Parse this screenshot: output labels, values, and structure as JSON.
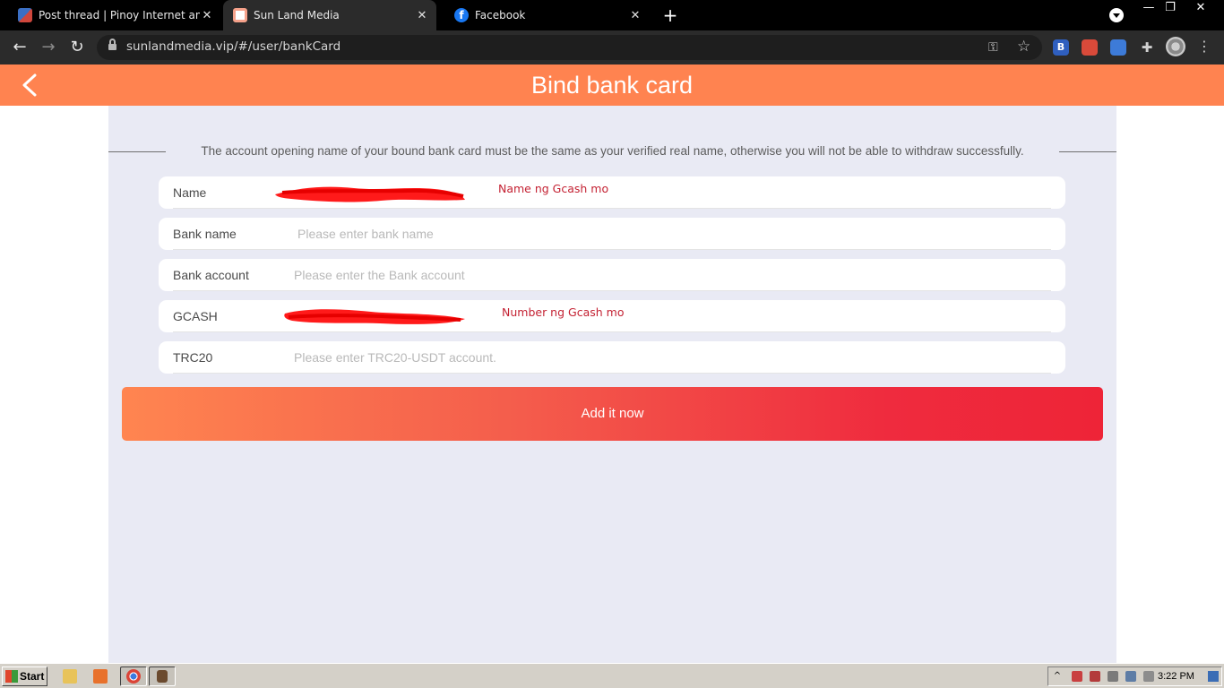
{
  "browser": {
    "tabs": [
      {
        "title": "Post thread | Pinoy Internet and Tec",
        "active": false
      },
      {
        "title": "Sun Land Media",
        "active": true
      },
      {
        "title": "Facebook",
        "active": false
      }
    ],
    "url": "sunlandmedia.vip/#/user/bankCard",
    "new_tab_label": "+",
    "window_controls": {
      "minimize": "—",
      "maximize": "❐",
      "close": "✕"
    }
  },
  "page": {
    "title": "Bind bank card",
    "notice": "The account opening name of your bound bank card must be the same as your verified real name, otherwise you will not be able to withdraw successfully.",
    "fields": [
      {
        "label": "Name",
        "value": "",
        "placeholder": "",
        "annotation": "Name ng Gcash mo"
      },
      {
        "label": "Bank name",
        "value": "",
        "placeholder": "Please enter bank name"
      },
      {
        "label": "Bank account",
        "value": "",
        "placeholder": "Please enter the Bank account"
      },
      {
        "label": "GCASH",
        "value": "",
        "placeholder": "",
        "annotation": "Number ng Gcash mo"
      },
      {
        "label": "TRC20",
        "value": "",
        "placeholder": "Please enter TRC20-USDT account."
      }
    ],
    "submit_label": "Add it now"
  },
  "taskbar": {
    "start_label": "Start",
    "clock": "3:22 PM"
  },
  "colors": {
    "header": "#ff8350",
    "content_bg": "#e9eaf4",
    "button_start": "#ff8550",
    "button_end": "#ee2437",
    "annotation": "#c42233",
    "redaction": "#ff1a1a"
  },
  "icons": {
    "back": "chevron-left-icon",
    "lock": "lock-icon",
    "key": "key-icon",
    "bookmark": "star-icon",
    "extensions": "puzzle-icon"
  }
}
